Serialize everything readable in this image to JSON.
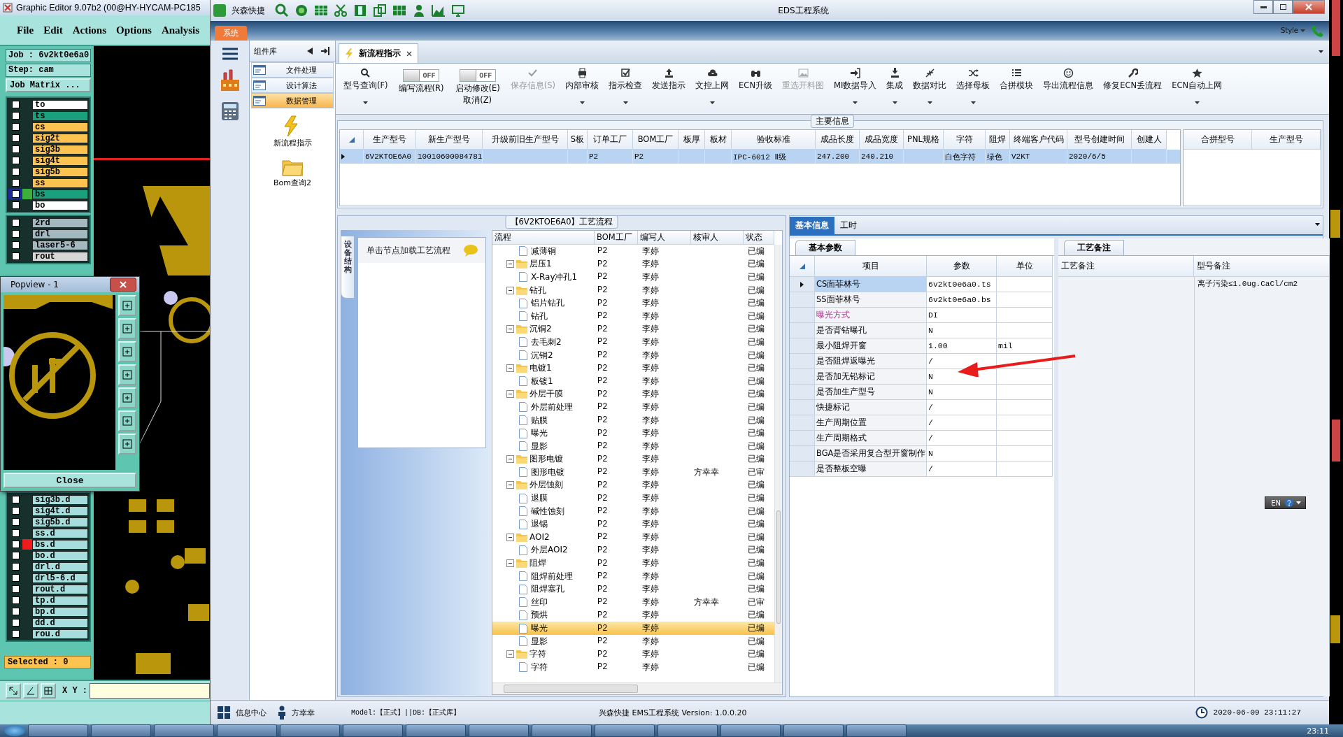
{
  "cam": {
    "title": "Graphic Editor 9.07b2 (00@HY-HYCAM-PC185",
    "menu": [
      "File",
      "Edit",
      "Actions",
      "Options",
      "Analysis"
    ],
    "job": "Job : 6v2kt0e6a0",
    "step": "Step: cam",
    "job_matrix": "Job Matrix ...",
    "layers": [
      {
        "name": "to",
        "color": "#ffffff",
        "selected": false,
        "checked": false
      },
      {
        "name": "ts",
        "color": "#1ba07d",
        "selected": false,
        "checked": false
      },
      {
        "name": "cs",
        "color": "#fcc350",
        "selected": false,
        "checked": false
      },
      {
        "name": "sig2t",
        "color": "#fcc350",
        "selected": false,
        "checked": false
      },
      {
        "name": "sig3b",
        "color": "#fcc350",
        "selected": false,
        "checked": false
      },
      {
        "name": "sig4t",
        "color": "#fcc350",
        "selected": false,
        "checked": false
      },
      {
        "name": "sig5b",
        "color": "#fcc350",
        "selected": false,
        "checked": false
      },
      {
        "name": "ss",
        "color": "#fcc350",
        "selected": false,
        "checked": false
      },
      {
        "name": "bs",
        "color": "#1ba07d",
        "selected": true,
        "checked": false
      },
      {
        "name": "bo",
        "color": "#ffffff",
        "selected": false,
        "checked": false
      }
    ],
    "drill_layers": [
      {
        "name": "2rd",
        "color": "#a4b8c0",
        "checked": false
      },
      {
        "name": "drl",
        "color": "#a4b8c0",
        "checked": false
      },
      {
        "name": "laser5-6",
        "color": "#a4b8c0",
        "checked": false
      },
      {
        "name": "rout",
        "color": "#d6d6d6",
        "checked": false
      }
    ],
    "output_layers": [
      {
        "name": "sig3b.d",
        "flagged": false,
        "checked": false
      },
      {
        "name": "sig4t.d",
        "flagged": false,
        "checked": false
      },
      {
        "name": "sig5b.d",
        "flagged": false,
        "checked": false
      },
      {
        "name": "ss.d",
        "flagged": false,
        "checked": false
      },
      {
        "name": "bs.d",
        "flagged": true,
        "checked": false
      },
      {
        "name": "bo.d",
        "flagged": false,
        "checked": false
      },
      {
        "name": "drl.d",
        "flagged": false,
        "checked": false
      },
      {
        "name": "drl5-6.d",
        "flagged": false,
        "checked": false
      },
      {
        "name": "rout.d",
        "flagged": false,
        "checked": false
      },
      {
        "name": "tp.d",
        "flagged": false,
        "checked": false
      },
      {
        "name": "bp.d",
        "flagged": false,
        "checked": false
      },
      {
        "name": "dd.d",
        "flagged": false,
        "checked": false
      },
      {
        "name": "rou.d",
        "flagged": false,
        "checked": false
      }
    ],
    "selected_count": "Selected : 0",
    "xy_label": "X Y :",
    "popview": {
      "title": "Popview - 1",
      "close_label": "Close"
    }
  },
  "eds": {
    "app_name": "兴森快捷",
    "title": "EDS工程系统",
    "system_tab": "系统",
    "style_label": "Style",
    "nav": {
      "title": "组件库",
      "categories": [
        {
          "label": "文件处理",
          "selected": false
        },
        {
          "label": "设计算法",
          "selected": false
        },
        {
          "label": "数据管理",
          "selected": true
        }
      ],
      "items": [
        "新流程指示",
        "Bom查询2"
      ]
    },
    "doc_tab": "新流程指示",
    "toolbar": [
      {
        "kind": "button",
        "label": "型号查询(F)",
        "disabled": false,
        "dropdown": true
      },
      {
        "kind": "toggle",
        "label": "编写流程(R)",
        "state_text": "OFF",
        "on": false
      },
      {
        "kind": "toggle",
        "label": "启动修改(E)",
        "sublabel": "取消(Z)",
        "state_text": "OFF",
        "on": false
      },
      {
        "kind": "button",
        "label": "保存信息(S)",
        "disabled": true,
        "dropdown": false
      },
      {
        "kind": "button",
        "label": "内部审核",
        "disabled": false,
        "dropdown": true
      },
      {
        "kind": "button",
        "label": "指示检查",
        "disabled": false,
        "dropdown": true
      },
      {
        "kind": "button",
        "label": "发送指示",
        "disabled": false,
        "dropdown": false
      },
      {
        "kind": "button",
        "label": "文控上网",
        "disabled": false,
        "dropdown": true
      },
      {
        "kind": "button",
        "label": "ECN升级",
        "disabled": false,
        "dropdown": false
      },
      {
        "kind": "button",
        "label": "重选开料图",
        "disabled": true,
        "dropdown": false
      },
      {
        "kind": "button",
        "label": "MI数据导入",
        "disabled": false,
        "dropdown": true
      },
      {
        "kind": "button",
        "label": "集成",
        "disabled": false,
        "dropdown": true
      },
      {
        "kind": "button",
        "label": "数据对比",
        "disabled": false,
        "dropdown": true
      },
      {
        "kind": "button",
        "label": "选择母板",
        "disabled": false,
        "dropdown": true
      },
      {
        "kind": "button",
        "label": "合拼模块",
        "disabled": false,
        "dropdown": false
      },
      {
        "kind": "button",
        "label": "导出流程信息",
        "disabled": false,
        "dropdown": false
      },
      {
        "kind": "button",
        "label": "修复ECN丢流程",
        "disabled": false,
        "dropdown": false
      },
      {
        "kind": "button",
        "label": "ECN自动上网",
        "disabled": false,
        "dropdown": true
      }
    ],
    "main_info": {
      "title": "主要信息",
      "columns": [
        "生产型号",
        "新生产型号",
        "升级前旧生产型号",
        "S板",
        "订单工厂",
        "BOM工厂",
        "板厚",
        "板材",
        "验收标准",
        "成品长度",
        "成品宽度",
        "PNL规格",
        "字符",
        "阻焊",
        "终端客户代码",
        "型号创建时间",
        "创建人"
      ],
      "rows": [
        {
          "selected": true,
          "cells": [
            "6V2KTOE6A0",
            "10010600084781",
            null,
            null,
            "P2",
            "P2",
            null,
            null,
            "IPC-6012 Ⅱ级",
            "247.200",
            "240.210",
            null,
            "白色字符",
            "绿色",
            "V2KT",
            "2020/6/5",
            null
          ]
        }
      ],
      "side_columns": [
        "合拼型号",
        "生产型号"
      ]
    },
    "process": {
      "title": "【6V2KTOE6A0】工艺流程",
      "side_tab": "设备结构",
      "hint": "单击节点加载工艺流程",
      "columns": [
        "流程",
        "BOM工厂",
        "编写人",
        "核审人",
        "状态"
      ],
      "tree": [
        {
          "kind": "leaf",
          "name": "减薄铜",
          "bom": "P2",
          "writer": "李婷",
          "status": "已编",
          "selected": false
        },
        {
          "kind": "folder",
          "name": "层压1",
          "bom": "P2",
          "writer": "李婷",
          "status": "已编",
          "selected": false,
          "children": [
            {
              "kind": "leaf",
              "name": "X-Ray冲孔1",
              "bom": "P2",
              "writer": "李婷",
              "status": "已编",
              "selected": false
            }
          ]
        },
        {
          "kind": "folder",
          "name": "钻孔",
          "bom": "P2",
          "writer": "李婷",
          "status": "已编",
          "selected": false,
          "children": [
            {
              "kind": "leaf",
              "name": "铝片钻孔",
              "bom": "P2",
              "writer": "李婷",
              "status": "已编",
              "selected": false
            },
            {
              "kind": "leaf",
              "name": "钻孔",
              "bom": "P2",
              "writer": "李婷",
              "status": "已编",
              "selected": false
            }
          ]
        },
        {
          "kind": "folder",
          "name": "沉铜2",
          "bom": "P2",
          "writer": "李婷",
          "status": "已编",
          "selected": false,
          "children": [
            {
              "kind": "leaf",
              "name": "去毛刺2",
              "bom": "P2",
              "writer": "李婷",
              "status": "已编",
              "selected": false
            },
            {
              "kind": "leaf",
              "name": "沉铜2",
              "bom": "P2",
              "writer": "李婷",
              "status": "已编",
              "selected": false
            }
          ]
        },
        {
          "kind": "folder",
          "name": "电镀1",
          "bom": "P2",
          "writer": "李婷",
          "status": "已编",
          "selected": false,
          "children": [
            {
              "kind": "leaf",
              "name": "板镀1",
              "bom": "P2",
              "writer": "李婷",
              "status": "已编",
              "selected": false
            }
          ]
        },
        {
          "kind": "folder",
          "name": "外层干膜",
          "bom": "P2",
          "writer": "李婷",
          "status": "已编",
          "selected": false,
          "children": [
            {
              "kind": "leaf",
              "name": "外层前处理",
              "bom": "P2",
              "writer": "李婷",
              "status": "已编",
              "selected": false
            },
            {
              "kind": "leaf",
              "name": "贴膜",
              "bom": "P2",
              "writer": "李婷",
              "status": "已编",
              "selected": false
            },
            {
              "kind": "leaf",
              "name": "曝光",
              "bom": "P2",
              "writer": "李婷",
              "status": "已编",
              "selected": false
            },
            {
              "kind": "leaf",
              "name": "显影",
              "bom": "P2",
              "writer": "李婷",
              "status": "已编",
              "selected": false
            }
          ]
        },
        {
          "kind": "folder",
          "name": "图形电镀",
          "bom": "P2",
          "writer": "李婷",
          "status": "已编",
          "selected": false,
          "children": [
            {
              "kind": "leaf",
              "name": "图形电镀",
              "bom": "P2",
              "writer": "李婷",
              "reviewer": "方幸幸",
              "status": "已审",
              "selected": false
            }
          ]
        },
        {
          "kind": "folder",
          "name": "外层蚀刻",
          "bom": "P2",
          "writer": "李婷",
          "status": "已编",
          "selected": false,
          "children": [
            {
              "kind": "leaf",
              "name": "退膜",
              "bom": "P2",
              "writer": "李婷",
              "status": "已编",
              "selected": false
            },
            {
              "kind": "leaf",
              "name": "碱性蚀刻",
              "bom": "P2",
              "writer": "李婷",
              "status": "已编",
              "selected": false
            },
            {
              "kind": "leaf",
              "name": "退锡",
              "bom": "P2",
              "writer": "李婷",
              "status": "已编",
              "selected": false
            }
          ]
        },
        {
          "kind": "folder",
          "name": "AOI2",
          "bom": "P2",
          "writer": "李婷",
          "status": "已编",
          "selected": false,
          "children": [
            {
              "kind": "leaf",
              "name": "外层AOI2",
              "bom": "P2",
              "writer": "李婷",
              "status": "已编",
              "selected": false
            }
          ]
        },
        {
          "kind": "folder",
          "name": "阻焊",
          "bom": "P2",
          "writer": "李婷",
          "status": "已编",
          "selected": false,
          "children": [
            {
              "kind": "leaf",
              "name": "阻焊前处理",
              "bom": "P2",
              "writer": "李婷",
              "status": "已编",
              "selected": false
            },
            {
              "kind": "leaf",
              "name": "阻焊塞孔",
              "bom": "P2",
              "writer": "李婷",
              "status": "已编",
              "selected": false
            },
            {
              "kind": "leaf",
              "name": "丝印",
              "bom": "P2",
              "writer": "李婷",
              "reviewer": "方幸幸",
              "status": "已审",
              "selected": false
            },
            {
              "kind": "leaf",
              "name": "预烘",
              "bom": "P2",
              "writer": "李婷",
              "status": "已编",
              "selected": false
            },
            {
              "kind": "leaf",
              "name": "曝光",
              "bom": "P2",
              "writer": "李婷",
              "status": "已编",
              "selected": true
            },
            {
              "kind": "leaf",
              "name": "显影",
              "bom": "P2",
              "writer": "李婷",
              "status": "已编",
              "selected": false
            }
          ]
        },
        {
          "kind": "folder",
          "name": "字符",
          "bom": "P2",
          "writer": "李婷",
          "status": "已编",
          "selected": false,
          "children": [
            {
              "kind": "leaf",
              "name": "字符",
              "bom": "P2",
              "writer": "李婷",
              "status": "已编",
              "selected": false
            }
          ]
        }
      ]
    },
    "params": {
      "tabs": [
        {
          "label": "基本信息",
          "selected": true
        },
        {
          "label": "工时",
          "selected": false
        }
      ],
      "section_tab": "基本参数",
      "columns": [
        "项目",
        "参数",
        "单位"
      ],
      "rows": [
        {
          "item": "CS面菲林号",
          "value": "6v2kt0e6a0.ts",
          "selected": true,
          "highlighted": false
        },
        {
          "item": "SS面菲林号",
          "value": "6v2kt0e6a0.bs",
          "selected": false,
          "highlighted": false
        },
        {
          "item": "曝光方式",
          "value": "DI",
          "selected": false,
          "highlighted": true
        },
        {
          "item": "是否背钻曝孔",
          "value": "N",
          "selected": false,
          "highlighted": false
        },
        {
          "item": "最小阻焊开窗",
          "value": "1.00",
          "unit": "mil",
          "selected": false,
          "highlighted": false
        },
        {
          "item": "是否阻焊返曝光",
          "value": "/",
          "selected": false,
          "highlighted": false
        },
        {
          "item": "是否加无铅标记",
          "value": "N",
          "selected": false,
          "highlighted": false
        },
        {
          "item": "是否加生产型号",
          "value": "N",
          "selected": false,
          "highlighted": false
        },
        {
          "item": "快捷标记",
          "value": "/",
          "selected": false,
          "highlighted": false
        },
        {
          "item": "生产周期位置",
          "value": "/",
          "selected": false,
          "highlighted": false
        },
        {
          "item": "生产周期格式",
          "value": "/",
          "selected": false,
          "highlighted": false
        },
        {
          "item": "BGA是否采用复合型开窗制作",
          "value": "N",
          "selected": false,
          "highlighted": false
        },
        {
          "item": "是否整板空曝",
          "value": "/",
          "selected": false,
          "highlighted": false
        }
      ]
    },
    "notes": {
      "tab": "工艺备注",
      "columns": [
        "工艺备注",
        "型号备注"
      ],
      "model_note": "离子污染≤1.0ug.CaCl/cm2"
    },
    "ime": {
      "label": "EN"
    },
    "status_bar": {
      "info_center": "信息中心",
      "user": "方幸幸",
      "model_db": "Model:【正式】||DB:【正式库】",
      "version": "兴森快捷 EMS工程系统 Version: 1.0.0.20",
      "datetime": "2020-06-09 23:11:27"
    }
  },
  "taskbar": {
    "clock": "23:11"
  }
}
